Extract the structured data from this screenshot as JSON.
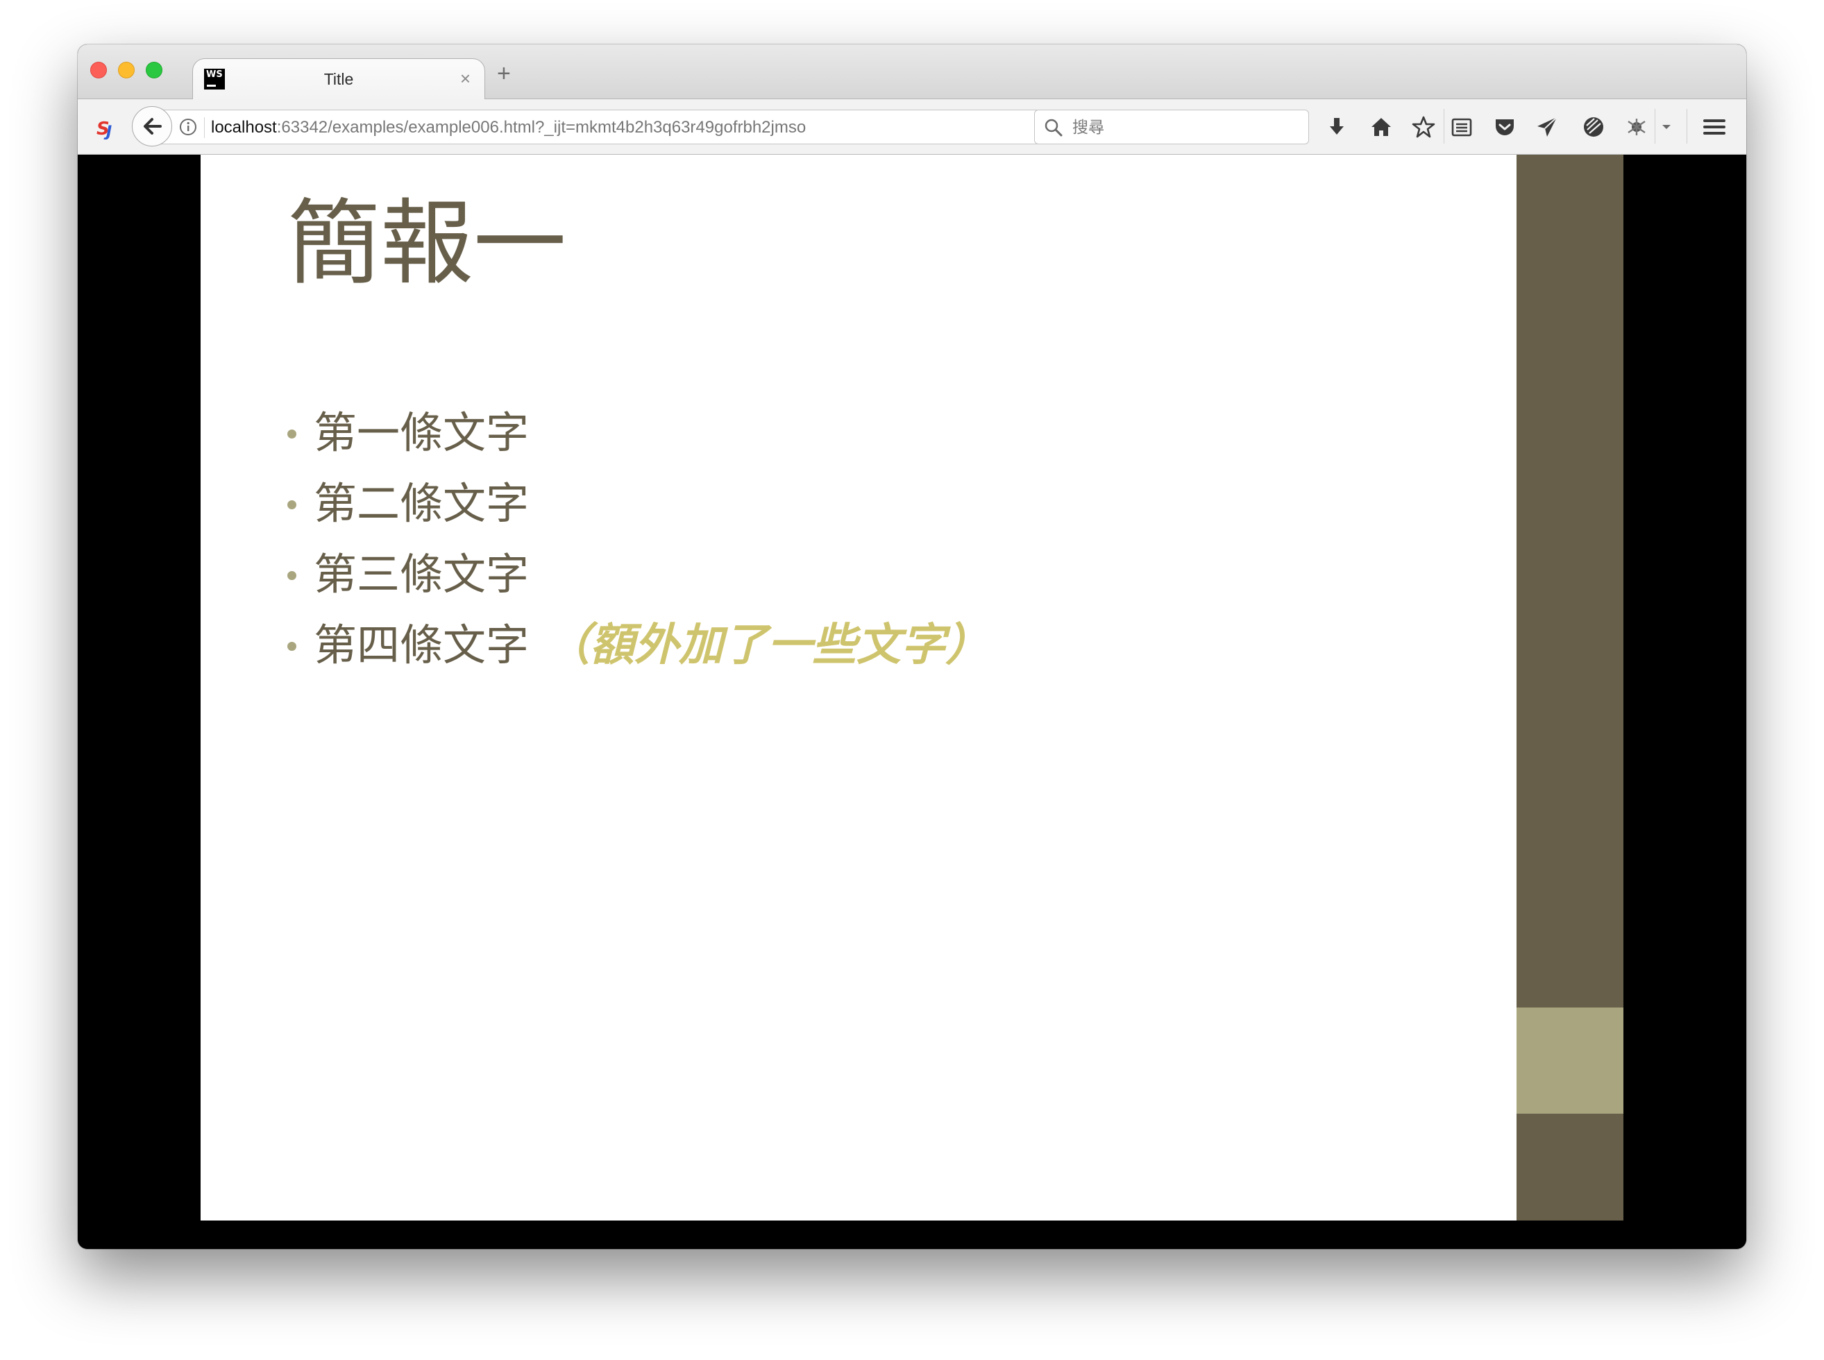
{
  "tab": {
    "title": "Title",
    "favicon_text": "WS",
    "close_glyph": "×"
  },
  "new_tab_glyph": "+",
  "url": {
    "host": "localhost",
    "rest": ":63342/examples/example006.html?_ijt=mkmt4b2h3q63r49gofrbh2jmso"
  },
  "search": {
    "placeholder": "搜尋"
  },
  "toolbar_icons": [
    "download-icon",
    "home-icon",
    "bookmark-star-icon",
    "reader-list-icon",
    "pocket-icon",
    "send-icon",
    "tracking-icon",
    "extension-icon",
    "overflow-chevron-icon",
    "hamburger-menu-icon"
  ],
  "slide": {
    "title": "簡報一",
    "items": [
      {
        "text": "第一條文字",
        "extra": ""
      },
      {
        "text": "第二條文字",
        "extra": ""
      },
      {
        "text": "第三條文字",
        "extra": ""
      },
      {
        "text": "第四條文字",
        "extra": "（額外加了一些文字）"
      }
    ],
    "progress": {
      "start_fraction": 0.8,
      "end_fraction": 0.9
    }
  },
  "colors": {
    "text": "#675f4a",
    "accent": "#cfc46e",
    "bullet": "#a9a67f",
    "sidebar": "#675f4a",
    "progress": "#a9a67f"
  }
}
